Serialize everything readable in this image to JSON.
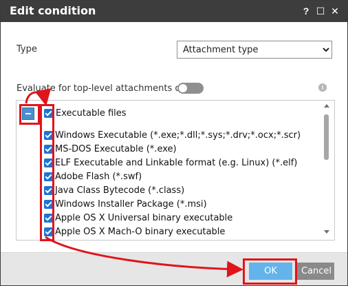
{
  "window": {
    "title": "Edit condition",
    "help": "?",
    "maximize": "☐",
    "close": "✕"
  },
  "form": {
    "type_label": "Type",
    "type_value": "Attachment type",
    "evaluate_label": "Evaluate for top-level attachments only",
    "info": "i"
  },
  "list": {
    "group_label": "Executable files",
    "items": [
      "Windows Executable (*.exe;*.dll;*.sys;*.drv;*.ocx;*.scr)",
      "MS-DOS Executable (*.exe)",
      "ELF Executable and Linkable format (e.g. Linux) (*.elf)",
      "Adobe Flash (*.swf)",
      "Java Class Bytecode (*.class)",
      "Windows Installer Package (*.msi)",
      "Apple OS X Universal binary executable",
      "Apple OS X Mach-O binary executable"
    ]
  },
  "footer": {
    "ok_label": "OK",
    "cancel_label": "Cancel"
  },
  "colors": {
    "titlebar": "#3d3d3d",
    "checkbox": "#1e74d6",
    "ok_button": "#62b4ea",
    "highlight": "#e0141b"
  }
}
